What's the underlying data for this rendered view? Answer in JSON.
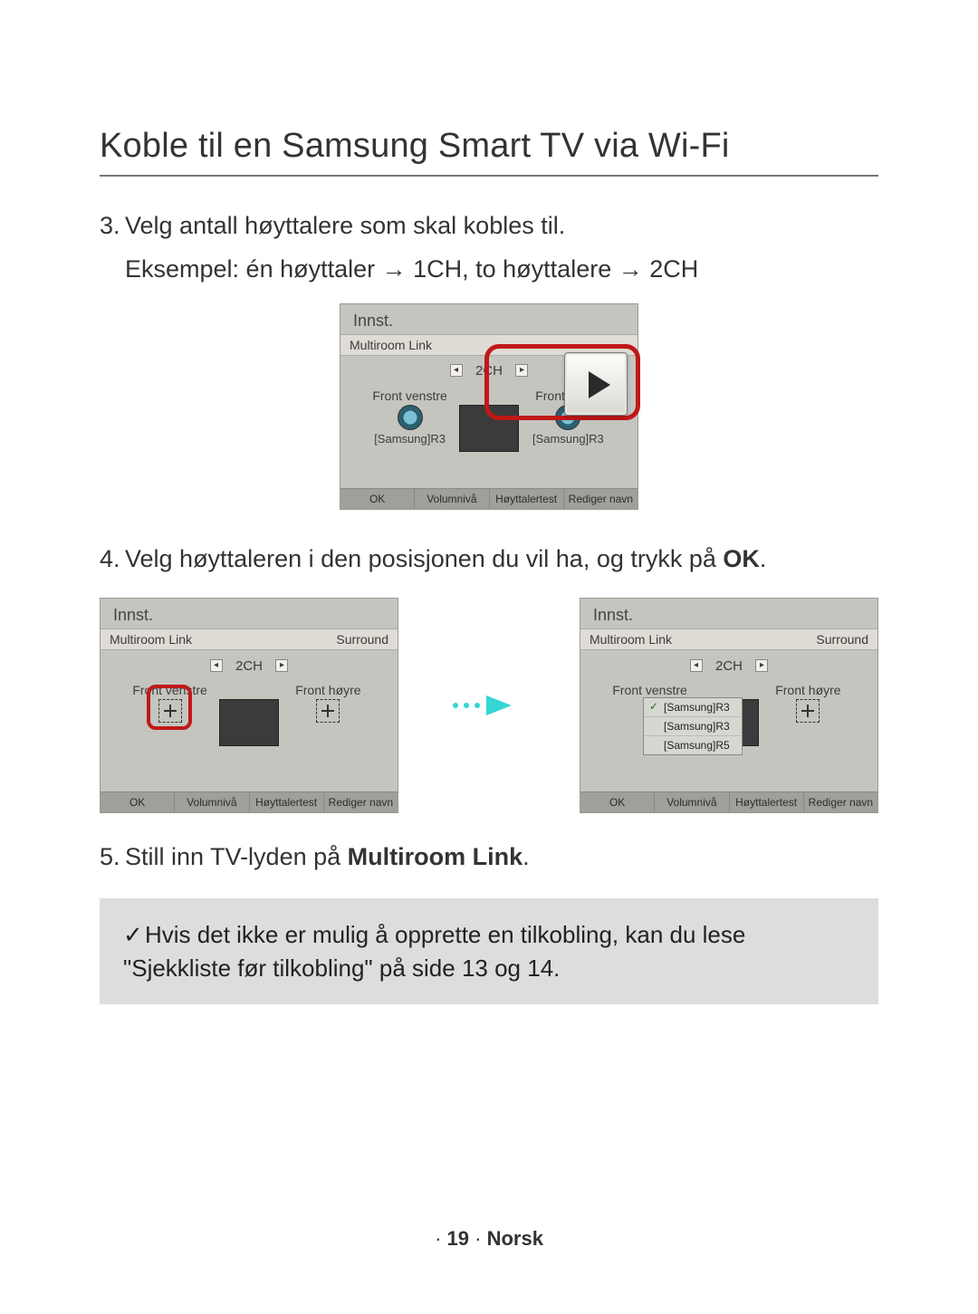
{
  "title": "Koble til en Samsung Smart TV via Wi-Fi",
  "step3": {
    "num": "3.",
    "line1": "Velg antall høyttalere som skal kobles til.",
    "line2a": "Eksempel: én høyttaler ",
    "line2b": " 1CH, to høyttalere ",
    "line2c": " 2CH",
    "arrow": "→"
  },
  "step4": {
    "num": "4.",
    "text": "Velg høyttaleren i den posisjonen du vil ha, og trykk på ",
    "ok": "OK",
    "dot": "."
  },
  "step5": {
    "num": "5.",
    "text": "Still inn TV-lyden på ",
    "ml": "Multiroom Link",
    "dot": "."
  },
  "panel": {
    "title": "Innst.",
    "subLeft": "Multiroom Link",
    "subRight": "Surround",
    "channel": "2CH",
    "frontLeft": "Front venstre",
    "frontRight": "Front høyre",
    "speakerName": "[Samsung]R3",
    "footer": {
      "a": "OK",
      "b": "Volumnivå",
      "c": "Høyttalertest",
      "d": "Rediger navn"
    }
  },
  "dropdown": {
    "items": [
      "[Samsung]R3",
      "[Samsung]R3",
      "[Samsung]R5"
    ]
  },
  "note": {
    "tick": "✓",
    "text": "Hvis det ikke er mulig å opprette en tilkobling, kan du lese \"Sjekkliste før tilkobling\" på side 13 og 14."
  },
  "footer": {
    "dot": "·",
    "page": "19",
    "lang": "Norsk"
  }
}
